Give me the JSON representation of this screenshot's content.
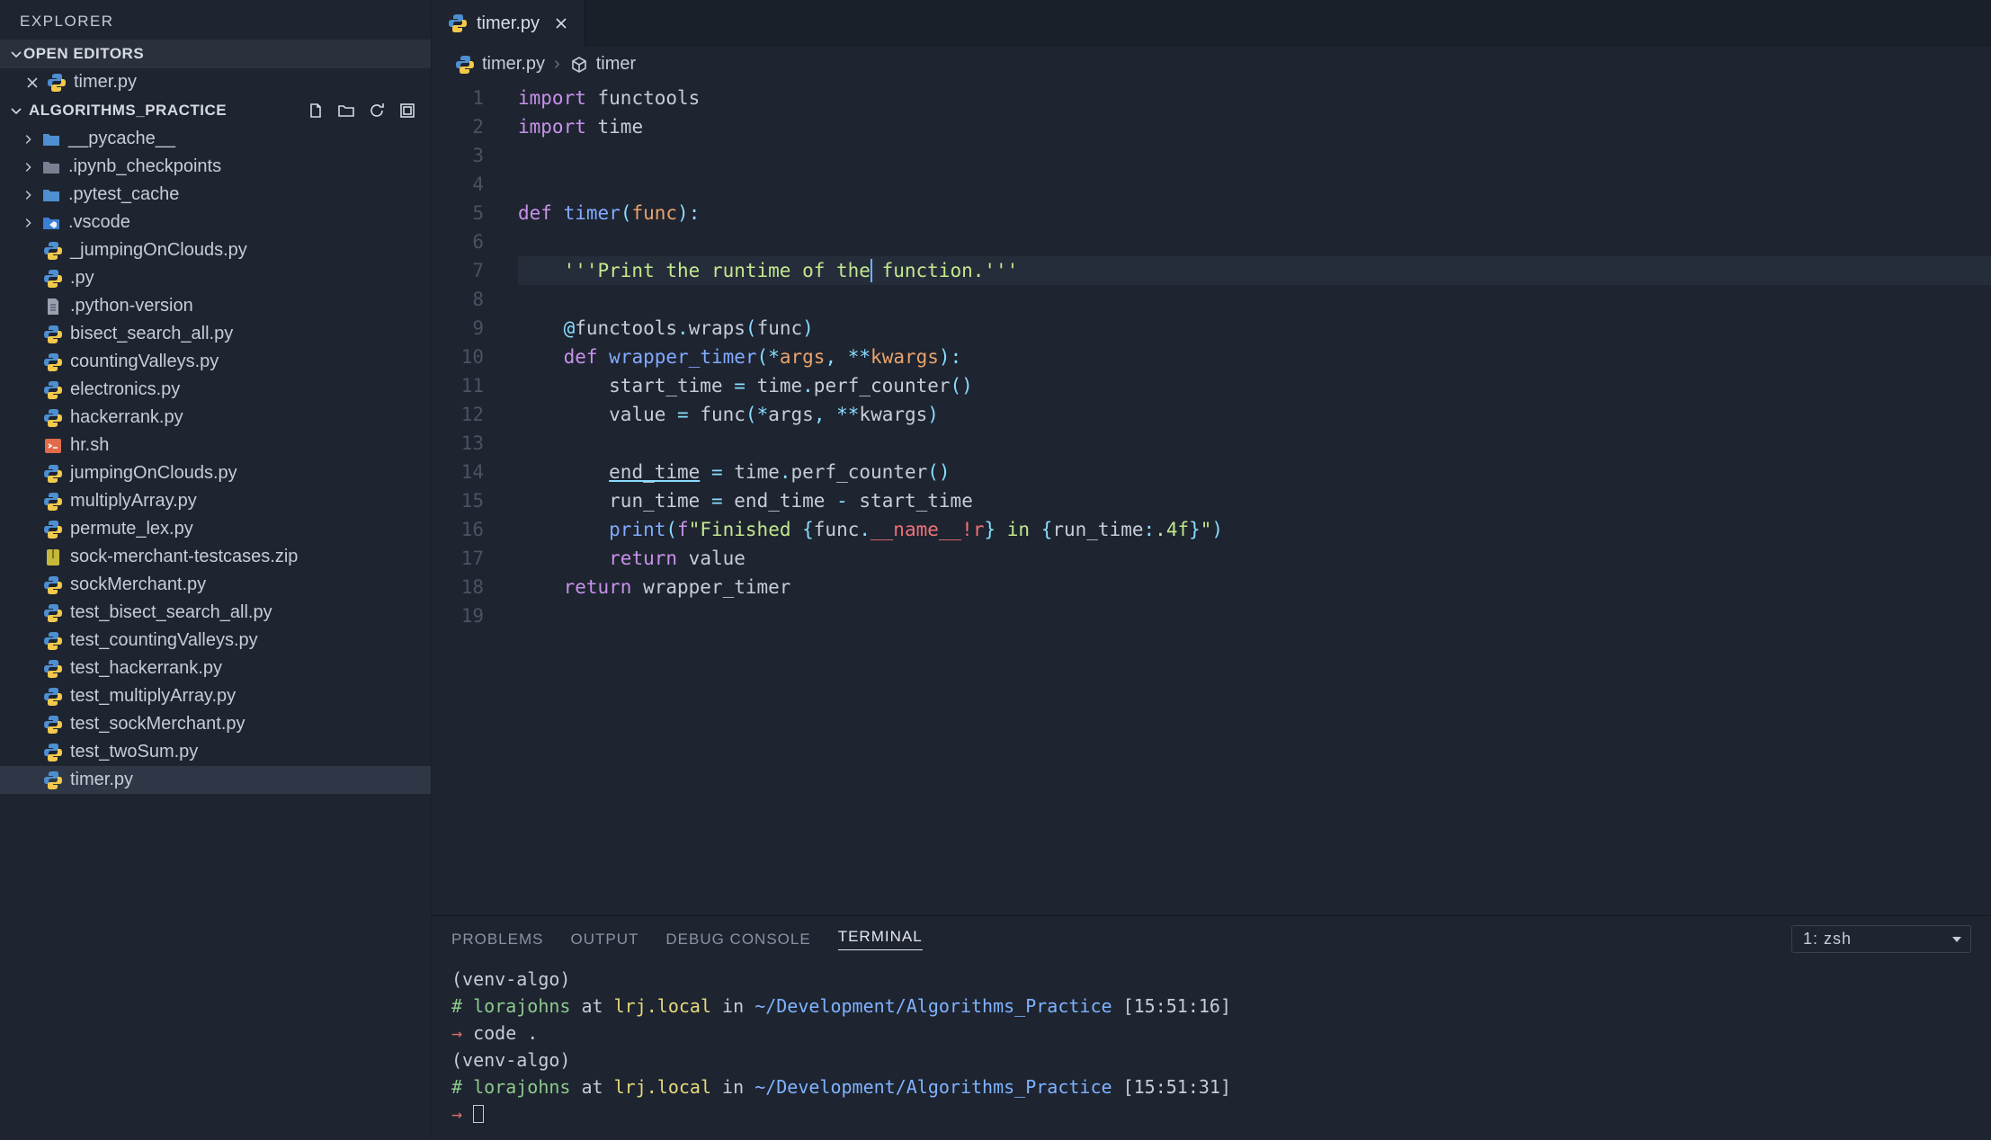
{
  "sidebar": {
    "explorer_label": "EXPLORER",
    "open_editors_label": "OPEN EDITORS",
    "open_editors": [
      {
        "name": "timer.py",
        "icon": "python"
      }
    ],
    "folder_label": "ALGORITHMS_PRACTICE",
    "tree": [
      {
        "type": "folder",
        "name": "__pycache__",
        "icon": "folder-blue"
      },
      {
        "type": "folder",
        "name": ".ipynb_checkpoints",
        "icon": "folder-grey"
      },
      {
        "type": "folder",
        "name": ".pytest_cache",
        "icon": "folder-blue"
      },
      {
        "type": "folder",
        "name": ".vscode",
        "icon": "folder-vscode"
      },
      {
        "type": "file",
        "name": "_jumpingOnClouds.py",
        "icon": "python"
      },
      {
        "type": "file",
        "name": ".py",
        "icon": "python"
      },
      {
        "type": "file",
        "name": ".python-version",
        "icon": "text"
      },
      {
        "type": "file",
        "name": "bisect_search_all.py",
        "icon": "python"
      },
      {
        "type": "file",
        "name": "countingValleys.py",
        "icon": "python"
      },
      {
        "type": "file",
        "name": "electronics.py",
        "icon": "python"
      },
      {
        "type": "file",
        "name": "hackerrank.py",
        "icon": "python"
      },
      {
        "type": "file",
        "name": "hr.sh",
        "icon": "shell"
      },
      {
        "type": "file",
        "name": "jumpingOnClouds.py",
        "icon": "python"
      },
      {
        "type": "file",
        "name": "multiplyArray.py",
        "icon": "python"
      },
      {
        "type": "file",
        "name": "permute_lex.py",
        "icon": "python"
      },
      {
        "type": "file",
        "name": "sock-merchant-testcases.zip",
        "icon": "zip"
      },
      {
        "type": "file",
        "name": "sockMerchant.py",
        "icon": "python"
      },
      {
        "type": "file",
        "name": "test_bisect_search_all.py",
        "icon": "python"
      },
      {
        "type": "file",
        "name": "test_countingValleys.py",
        "icon": "python"
      },
      {
        "type": "file",
        "name": "test_hackerrank.py",
        "icon": "python"
      },
      {
        "type": "file",
        "name": "test_multiplyArray.py",
        "icon": "python"
      },
      {
        "type": "file",
        "name": "test_sockMerchant.py",
        "icon": "python"
      },
      {
        "type": "file",
        "name": "test_twoSum.py",
        "icon": "python"
      },
      {
        "type": "file",
        "name": "timer.py",
        "icon": "python",
        "active": true
      }
    ]
  },
  "tabs": [
    {
      "name": "timer.py",
      "icon": "python"
    }
  ],
  "breadcrumbs": [
    {
      "icon": "python",
      "label": "timer.py"
    },
    {
      "icon": "symbol",
      "label": "timer"
    }
  ],
  "editor": {
    "lines": [
      [
        [
          "kw",
          "import"
        ],
        [
          "",
          " "
        ],
        [
          "id",
          "functools"
        ]
      ],
      [
        [
          "kw",
          "import"
        ],
        [
          "",
          " "
        ],
        [
          "id",
          "time"
        ]
      ],
      [],
      [],
      [
        [
          "kw",
          "def"
        ],
        [
          "",
          " "
        ],
        [
          "fn",
          "timer"
        ],
        [
          "op",
          "("
        ],
        [
          "pr",
          "func"
        ],
        [
          "op",
          ")"
        ],
        [
          "op",
          ":"
        ]
      ],
      [
        [
          "",
          "    "
        ]
      ],
      [
        [
          "",
          "    "
        ],
        [
          "str",
          "'''Print the runtime of the"
        ],
        [
          "cursor",
          ""
        ],
        [
          "str",
          " function.'''"
        ]
      ],
      [
        [
          "",
          "    "
        ]
      ],
      [
        [
          "",
          "    "
        ],
        [
          "op",
          "@"
        ],
        [
          "id",
          "functools"
        ],
        [
          "op",
          "."
        ],
        [
          "id",
          "wraps"
        ],
        [
          "op",
          "("
        ],
        [
          "id",
          "func"
        ],
        [
          "op",
          ")"
        ]
      ],
      [
        [
          "",
          "    "
        ],
        [
          "kw",
          "def"
        ],
        [
          "",
          " "
        ],
        [
          "fn",
          "wrapper_timer"
        ],
        [
          "op",
          "("
        ],
        [
          "op",
          "*"
        ],
        [
          "pr",
          "args"
        ],
        [
          "op",
          ","
        ],
        [
          "",
          " "
        ],
        [
          "op",
          "**"
        ],
        [
          "pr",
          "kwargs"
        ],
        [
          "op",
          ")"
        ],
        [
          "op",
          ":"
        ]
      ],
      [
        [
          "",
          "        "
        ],
        [
          "id",
          "start_time"
        ],
        [
          "",
          " "
        ],
        [
          "op",
          "="
        ],
        [
          "",
          " "
        ],
        [
          "id",
          "time"
        ],
        [
          "op",
          "."
        ],
        [
          "id",
          "perf_counter"
        ],
        [
          "op",
          "()"
        ]
      ],
      [
        [
          "",
          "        "
        ],
        [
          "id",
          "value"
        ],
        [
          "",
          " "
        ],
        [
          "op",
          "="
        ],
        [
          "",
          " "
        ],
        [
          "id",
          "func"
        ],
        [
          "op",
          "("
        ],
        [
          "op",
          "*"
        ],
        [
          "id",
          "args"
        ],
        [
          "op",
          ","
        ],
        [
          "",
          " "
        ],
        [
          "op",
          "**"
        ],
        [
          "id",
          "kwargs"
        ],
        [
          "op",
          ")"
        ]
      ],
      [
        [
          "",
          "        "
        ]
      ],
      [
        [
          "",
          "        "
        ],
        [
          "wav",
          "end_time"
        ],
        [
          "",
          " "
        ],
        [
          "op",
          "="
        ],
        [
          "",
          " "
        ],
        [
          "id",
          "time"
        ],
        [
          "op",
          "."
        ],
        [
          "id",
          "perf_counter"
        ],
        [
          "op",
          "()"
        ]
      ],
      [
        [
          "",
          "        "
        ],
        [
          "id",
          "run_time"
        ],
        [
          "",
          " "
        ],
        [
          "op",
          "="
        ],
        [
          "",
          " "
        ],
        [
          "id",
          "end_time"
        ],
        [
          "",
          " "
        ],
        [
          "op",
          "-"
        ],
        [
          "",
          " "
        ],
        [
          "id",
          "start_time"
        ]
      ],
      [
        [
          "",
          "        "
        ],
        [
          "fn",
          "print"
        ],
        [
          "op",
          "("
        ],
        [
          "kw",
          "f"
        ],
        [
          "str",
          "\"Finished "
        ],
        [
          "op",
          "{"
        ],
        [
          "id",
          "func"
        ],
        [
          "op",
          "."
        ],
        [
          "red",
          "__name__"
        ],
        [
          "red",
          "!r"
        ],
        [
          "op",
          "}"
        ],
        [
          "str",
          " in "
        ],
        [
          "op",
          "{"
        ],
        [
          "id",
          "run_time"
        ],
        [
          "op",
          ":"
        ],
        [
          "str",
          ".4f"
        ],
        [
          "op",
          "}"
        ],
        [
          "str",
          "\""
        ],
        [
          "op",
          ")"
        ]
      ],
      [
        [
          "",
          "        "
        ],
        [
          "kw",
          "return"
        ],
        [
          "",
          " "
        ],
        [
          "id",
          "value"
        ]
      ],
      [
        [
          "",
          "    "
        ],
        [
          "kw",
          "return"
        ],
        [
          "",
          " "
        ],
        [
          "id",
          "wrapper_timer"
        ]
      ],
      []
    ],
    "highlight_line": 7
  },
  "panel": {
    "tabs": [
      "PROBLEMS",
      "OUTPUT",
      "DEBUG CONSOLE",
      "TERMINAL"
    ],
    "active_tab": "TERMINAL",
    "term_dropdown": "1: zsh",
    "terminal_lines": [
      [
        [
          "",
          "(venv-algo)"
        ]
      ],
      [
        [
          "tg",
          "# "
        ],
        [
          "tg",
          "lorajohns"
        ],
        [
          "",
          " at "
        ],
        [
          "ty",
          "lrj.local"
        ],
        [
          "",
          " in "
        ],
        [
          "tb",
          "~/Development/Algorithms_Practice"
        ],
        [
          "",
          " "
        ],
        [
          "",
          "[15:51:16]"
        ]
      ],
      [
        [
          "tr",
          "→ "
        ],
        [
          "",
          "code ."
        ]
      ],
      [
        [
          "",
          "(venv-algo)"
        ]
      ],
      [
        [
          "tg",
          "# "
        ],
        [
          "tg",
          "lorajohns"
        ],
        [
          "",
          " at "
        ],
        [
          "ty",
          "lrj.local"
        ],
        [
          "",
          " in "
        ],
        [
          "tb",
          "~/Development/Algorithms_Practice"
        ],
        [
          "",
          " "
        ],
        [
          "",
          "[15:51:31]"
        ]
      ],
      [
        [
          "tr",
          "→ "
        ],
        [
          "box",
          ""
        ]
      ]
    ]
  }
}
